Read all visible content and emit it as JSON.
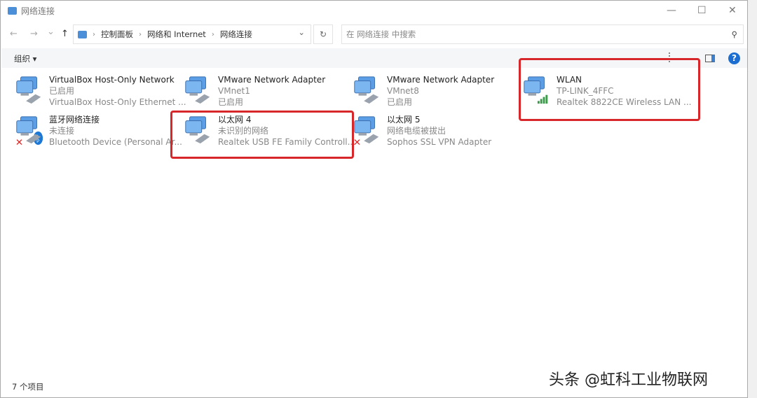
{
  "window": {
    "title": "网络连接",
    "minimize": "—",
    "maximize": "☐",
    "close": "✕"
  },
  "nav": {
    "back": "←",
    "forward": "→",
    "recent": "⌄",
    "up": "↑"
  },
  "breadcrumb": [
    "控制面板",
    "网络和 Internet",
    "网络连接"
  ],
  "address_dropdown": "⌄",
  "refresh": "↻",
  "search": {
    "placeholder": "在 网络连接 中搜索",
    "icon": "⚲"
  },
  "toolbar": {
    "organize": "组织 ▾",
    "help": "?"
  },
  "items": [
    {
      "name": "VirtualBox Host-Only Network",
      "line2": "已启用",
      "line3": "VirtualBox Host-Only Ethernet ...",
      "overlay": "none"
    },
    {
      "name": "VMware Network Adapter",
      "line2": "VMnet1",
      "line3": "已启用",
      "overlay": "none"
    },
    {
      "name": "VMware Network Adapter",
      "line2": "VMnet8",
      "line3": "已启用",
      "overlay": "none"
    },
    {
      "name": "WLAN",
      "line2": "TP-LINK_4FFC",
      "line3": "Realtek 8822CE Wireless LAN ...",
      "overlay": "wifi"
    },
    {
      "name": "蓝牙网络连接",
      "line2": "未连接",
      "line3": "Bluetooth Device (Personal Ar...",
      "overlay": "bluetooth"
    },
    {
      "name": "以太网 4",
      "line2": "未识别的网络",
      "line3": "Realtek USB FE Family Controll...",
      "overlay": "none"
    },
    {
      "name": "以太网 5",
      "line2": "网络电缆被拔出",
      "line3": "Sophos SSL VPN Adapter",
      "overlay": "x"
    }
  ],
  "status": "7 个项目",
  "watermark": "头条 @虹科工业物联网",
  "colors": {
    "highlight": "#d8272a",
    "help": "#1c6fd1"
  }
}
